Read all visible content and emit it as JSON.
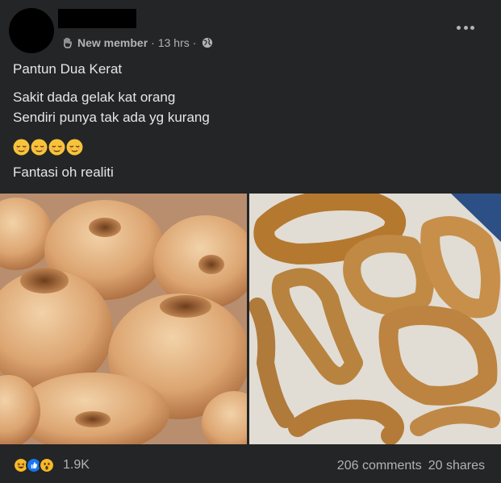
{
  "post": {
    "badge_label": "New member",
    "separator": "·",
    "time": "13 hrs",
    "lines": [
      "Pantun Dua Kerat",
      "Sakit dada gelak kat orang",
      "Sendiri punya tak ada yg kurang",
      "Fantasi oh realiti"
    ],
    "emoji_icons": [
      "relieved-face-icon",
      "relieved-face-icon",
      "relieved-face-icon",
      "relieved-face-icon"
    ],
    "photos": [
      {
        "subject": "sugared round doughnuts"
      },
      {
        "subject": "misshapen fried doughnuts on a plate"
      }
    ]
  },
  "footer": {
    "reaction_icons": [
      "haha-icon",
      "like-icon",
      "wow-icon"
    ],
    "reaction_count": "1.9K",
    "comments": "206 comments",
    "shares": "20 shares"
  },
  "colors": {
    "background": "#242526",
    "primary_text": "#e4e6eb",
    "secondary_text": "#b0b3b8",
    "like_blue": "#1877f2",
    "reaction_yellow": "#f7b928"
  }
}
